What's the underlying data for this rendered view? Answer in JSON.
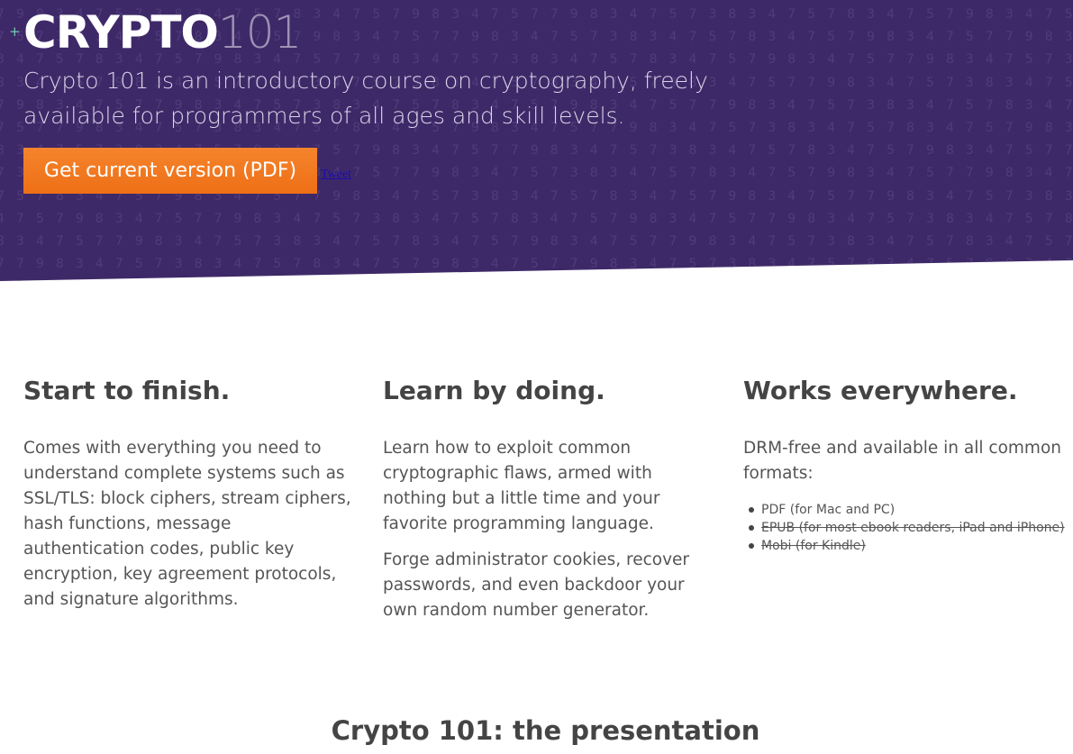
{
  "hero": {
    "brand_bold": "CRYPTO",
    "brand_light": "101",
    "plus": "+",
    "lead": "Crypto 101 is an introductory course on cryptography, freely available for programmers of all ages and skill levels.",
    "cta_label": "Get current version (PDF)",
    "tweet_label": "Tweet"
  },
  "features": [
    {
      "title": "Start to finish.",
      "paragraphs": [
        "Comes with everything you need to understand complete systems such as SSL/TLS: block ciphers, stream ciphers, hash functions, message authentication codes, public key encryption, key agreement protocols, and signature algorithms."
      ]
    },
    {
      "title": "Learn by doing.",
      "paragraphs": [
        "Learn how to exploit common cryptographic flaws, armed with nothing but a little time and your favorite programming language.",
        "Forge administrator cookies, recover passwords, and even backdoor your own random number generator."
      ]
    },
    {
      "title": "Works everywhere.",
      "paragraphs": [
        "DRM-free and available in all common formats:"
      ],
      "formats": [
        "PDF (for Mac and PC)",
        "EPUB (for most ebook readers, iPad and iPhone)",
        "Mobi (for Kindle)"
      ]
    }
  ],
  "presentation_title": "Crypto 101: the presentation",
  "colors": {
    "hero_bg": "#3e2968",
    "cta": "#f47a20",
    "text": "#444444"
  }
}
